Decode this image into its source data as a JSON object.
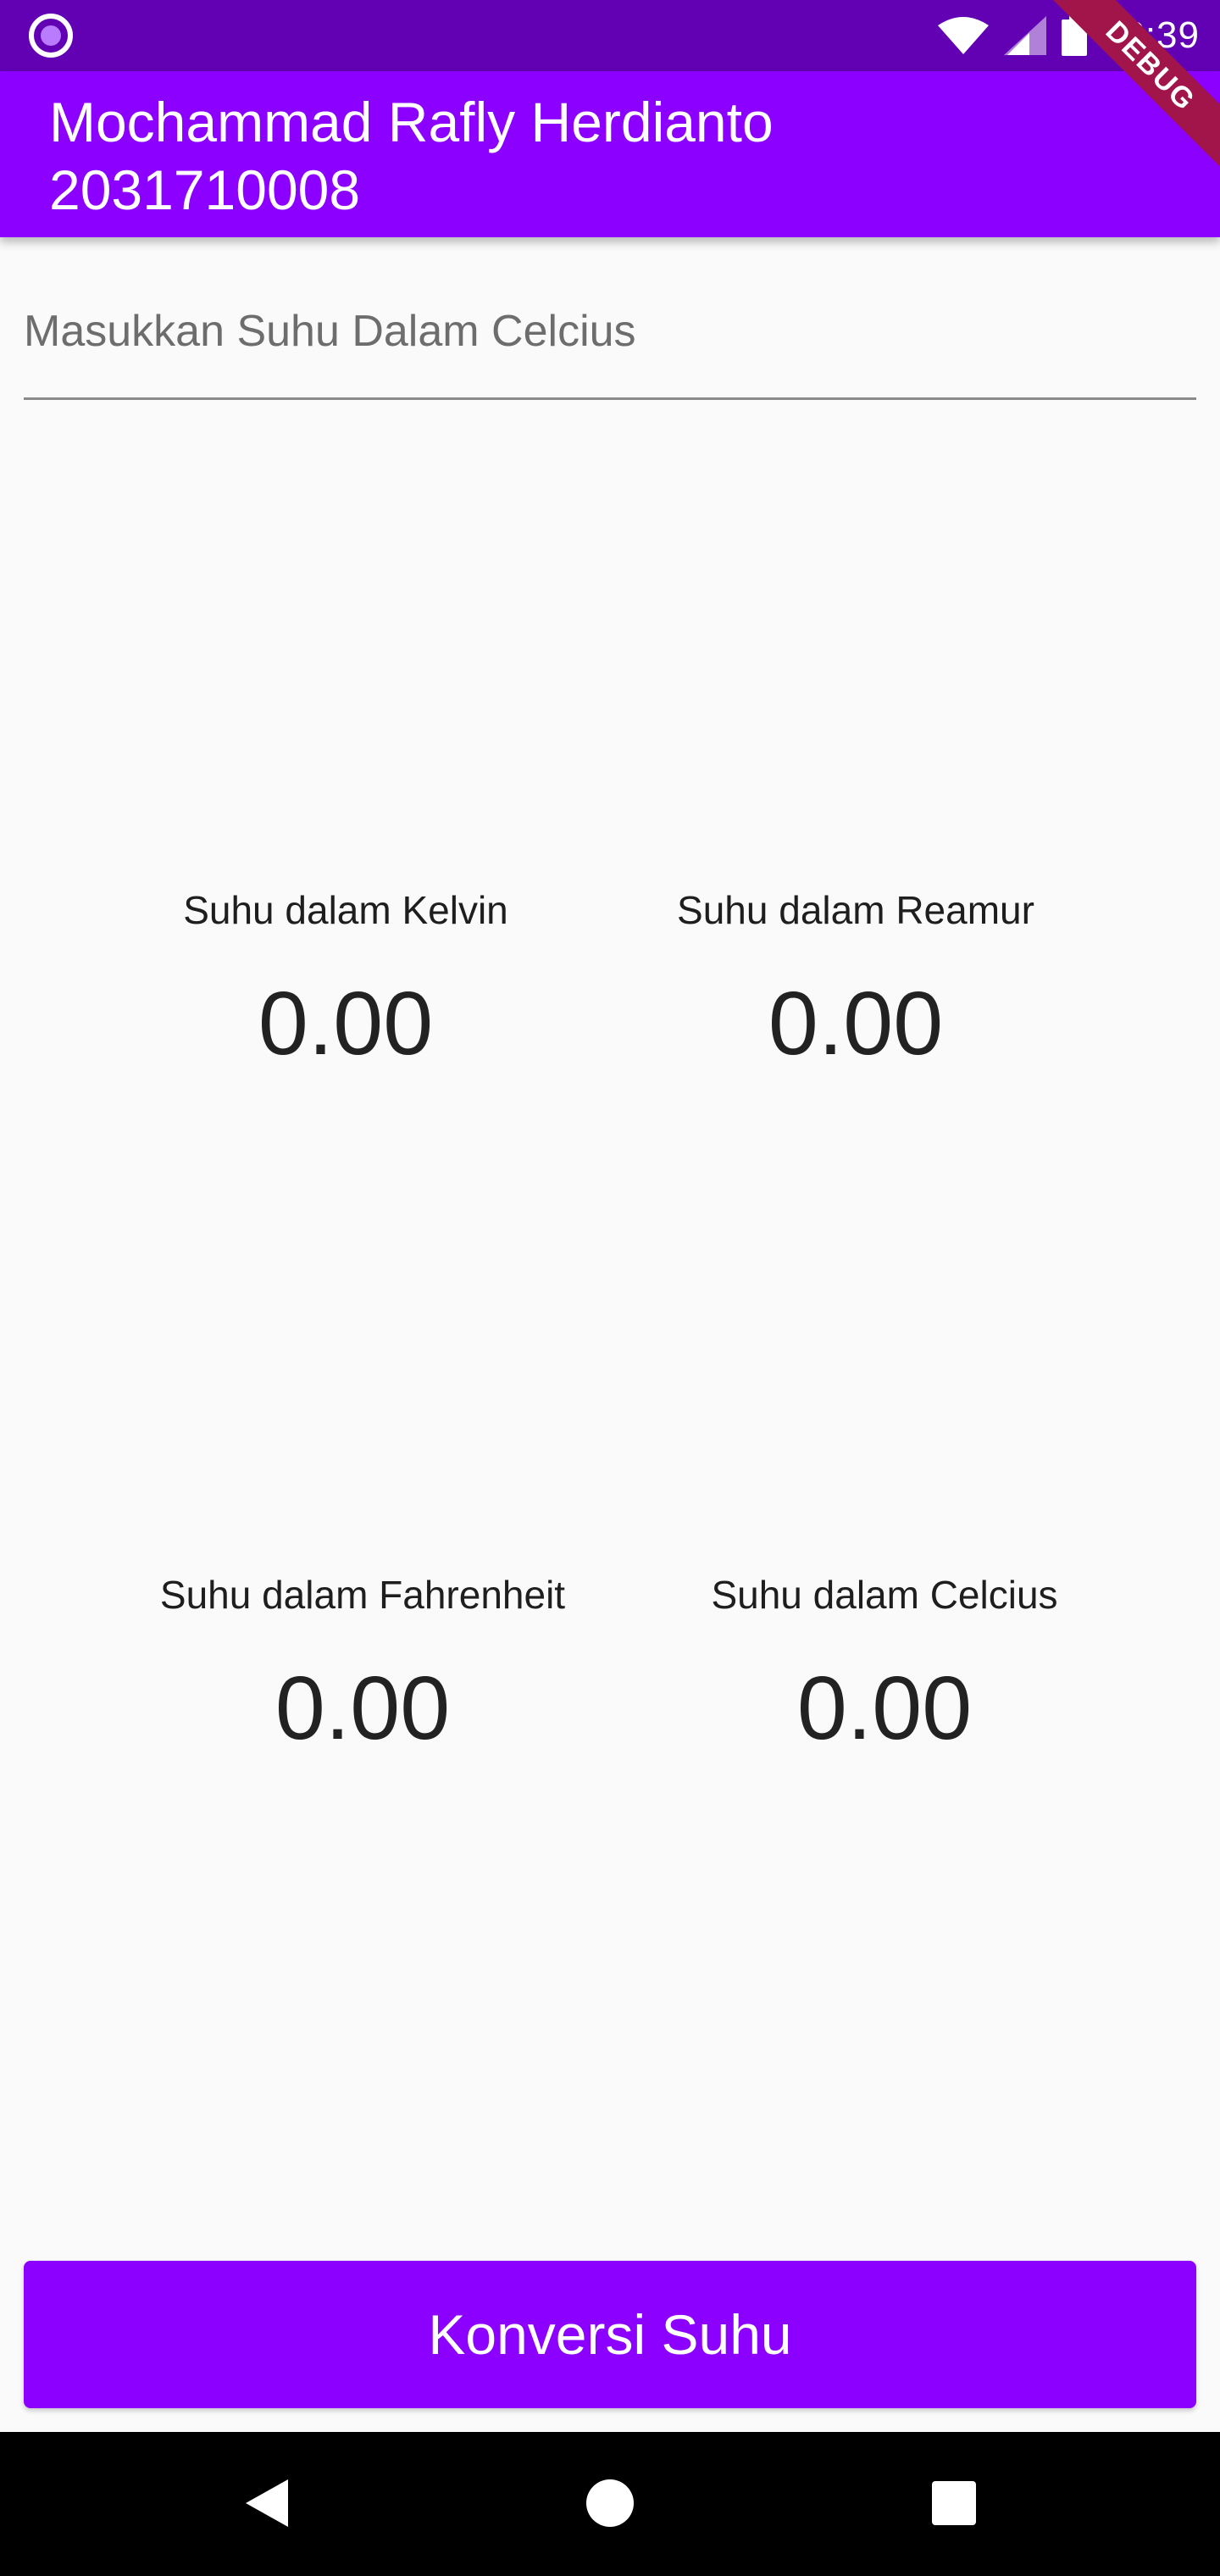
{
  "status_bar": {
    "time": "12:39",
    "icons": [
      "app-notification-icon",
      "wifi-icon",
      "cell-signal-icon",
      "battery-icon"
    ]
  },
  "app_bar": {
    "title": "Mochammad Rafly Herdianto\n2031710008",
    "color": "#8b00ff"
  },
  "debug_banner": "DEBUG",
  "input": {
    "placeholder": "Masukkan Suhu Dalam Celcius",
    "value": ""
  },
  "results": [
    {
      "label": "Suhu dalam Kelvin",
      "value": "0.00"
    },
    {
      "label": "Suhu dalam Reamur",
      "value": "0.00"
    },
    {
      "label": "Suhu dalam Fahrenheit",
      "value": "0.00"
    },
    {
      "label": "Suhu dalam Celcius",
      "value": "0.00"
    }
  ],
  "button": {
    "label": "Konversi Suhu"
  },
  "nav_bar": {
    "icons": [
      "back-icon",
      "home-icon",
      "recents-icon"
    ]
  }
}
